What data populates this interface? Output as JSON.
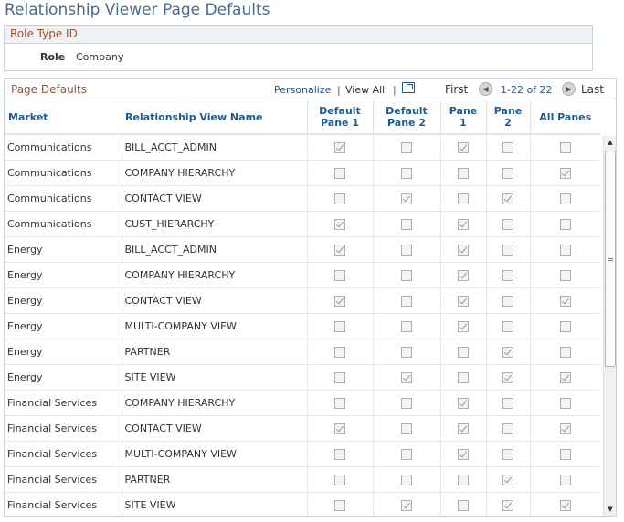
{
  "page": {
    "title": "Relationship Viewer Page Defaults"
  },
  "role_section": {
    "header": "Role Type ID",
    "role_label": "Role",
    "role_value": "Company"
  },
  "grid": {
    "title": "Page Defaults",
    "personalize": "Personalize",
    "separator": "|",
    "view_all": "View All",
    "first": "First",
    "range": "1-22 of 22",
    "last": "Last",
    "columns": [
      "Market",
      "Relationship View Name",
      "Default Pane 1",
      "Default Pane 2",
      "Pane 1",
      "Pane 2",
      "All Panes"
    ],
    "column_lines": [
      [
        "Market"
      ],
      [
        "Relationship View Name"
      ],
      [
        "Default",
        "Pane 1"
      ],
      [
        "Default",
        "Pane 2"
      ],
      [
        "Pane",
        "1"
      ],
      [
        "Pane",
        "2"
      ],
      [
        "All Panes"
      ]
    ],
    "rows": [
      {
        "market": "Communications",
        "view": "BILL_ACCT_ADMIN",
        "dp1": true,
        "dp2": false,
        "p1": true,
        "p2": false,
        "all": false
      },
      {
        "market": "Communications",
        "view": "COMPANY HIERARCHY",
        "dp1": false,
        "dp2": false,
        "p1": false,
        "p2": false,
        "all": true
      },
      {
        "market": "Communications",
        "view": "CONTACT VIEW",
        "dp1": false,
        "dp2": true,
        "p1": false,
        "p2": true,
        "all": false
      },
      {
        "market": "Communications",
        "view": "CUST_HIERARCHY",
        "dp1": true,
        "dp2": false,
        "p1": true,
        "p2": false,
        "all": false
      },
      {
        "market": "Energy",
        "view": "BILL_ACCT_ADMIN",
        "dp1": true,
        "dp2": false,
        "p1": true,
        "p2": false,
        "all": false
      },
      {
        "market": "Energy",
        "view": "COMPANY HIERARCHY",
        "dp1": false,
        "dp2": false,
        "p1": true,
        "p2": false,
        "all": false
      },
      {
        "market": "Energy",
        "view": "CONTACT VIEW",
        "dp1": true,
        "dp2": false,
        "p1": true,
        "p2": false,
        "all": true
      },
      {
        "market": "Energy",
        "view": "MULTI-COMPANY VIEW",
        "dp1": false,
        "dp2": false,
        "p1": true,
        "p2": false,
        "all": false
      },
      {
        "market": "Energy",
        "view": "PARTNER",
        "dp1": false,
        "dp2": false,
        "p1": false,
        "p2": true,
        "all": false
      },
      {
        "market": "Energy",
        "view": "SITE VIEW",
        "dp1": false,
        "dp2": true,
        "p1": false,
        "p2": true,
        "all": true
      },
      {
        "market": "Financial Services",
        "view": "COMPANY HIERARCHY",
        "dp1": false,
        "dp2": false,
        "p1": true,
        "p2": false,
        "all": false
      },
      {
        "market": "Financial Services",
        "view": "CONTACT VIEW",
        "dp1": true,
        "dp2": false,
        "p1": true,
        "p2": false,
        "all": true
      },
      {
        "market": "Financial Services",
        "view": "MULTI-COMPANY VIEW",
        "dp1": false,
        "dp2": false,
        "p1": true,
        "p2": false,
        "all": false
      },
      {
        "market": "Financial Services",
        "view": "PARTNER",
        "dp1": false,
        "dp2": false,
        "p1": false,
        "p2": true,
        "all": false
      },
      {
        "market": "Financial Services",
        "view": "SITE VIEW",
        "dp1": false,
        "dp2": true,
        "p1": false,
        "p2": true,
        "all": true
      }
    ]
  },
  "icons": {
    "zoom": "view-in-grid-icon",
    "prev": "chevron-left-icon",
    "next": "chevron-right-icon"
  }
}
